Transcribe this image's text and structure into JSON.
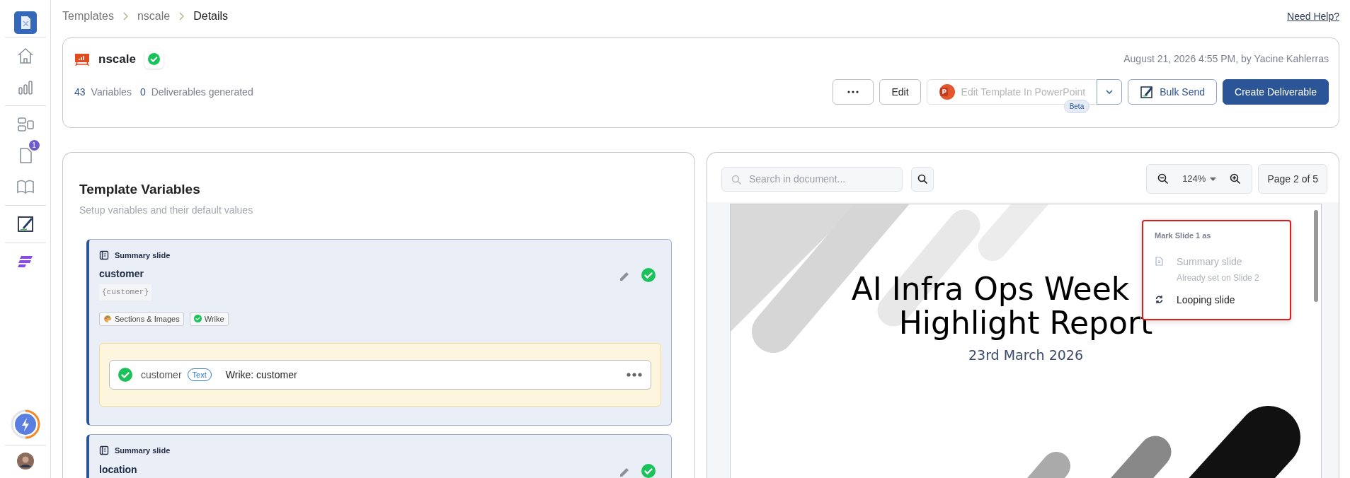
{
  "sidebar": {
    "items": [
      {
        "kind": "home"
      },
      {
        "kind": "chart"
      },
      {
        "kind": "layout"
      },
      {
        "kind": "document",
        "badge": "1"
      },
      {
        "kind": "book"
      },
      {
        "kind": "sign"
      },
      {
        "kind": "brand"
      }
    ]
  },
  "breadcrumb": [
    "Templates",
    "nscale",
    "Details"
  ],
  "help": "Need Help?",
  "template": {
    "name": "nscale",
    "verified": true,
    "updated": "August 21, 2026 4:55 PM, by Yacine Kahlerras",
    "stats": [
      {
        "count": "43",
        "label": "Variables"
      },
      {
        "count": "0",
        "label": "Deliverables generated"
      }
    ],
    "buttons": [
      {
        "kind": "more"
      },
      {
        "kind": "plain",
        "label": "Edit"
      },
      {
        "kind": "powerpoint",
        "label": "Edit Template In PowerPoint",
        "disabled": true,
        "badge": "Beta"
      },
      {
        "kind": "bulk",
        "label": "Bulk Send"
      },
      {
        "kind": "primary",
        "label": "Create Deliverable"
      }
    ]
  },
  "variables_panel": {
    "title": "Template Variables",
    "subtitle": "Setup variables and their default values",
    "variables": [
      {
        "slide_type": "Summary slide",
        "name": "customer",
        "token": "{customer}",
        "verified": true,
        "tags": [
          {
            "kind": "palette",
            "label": "Sections & Images"
          },
          {
            "kind": "check",
            "label": "Wrike"
          }
        ],
        "mappings": [
          {
            "name": "customer",
            "type": "Text",
            "source": "Wrike: customer",
            "verified": true
          }
        ]
      },
      {
        "slide_type": "Summary slide",
        "name": "location",
        "verified": true
      }
    ]
  },
  "viewer": {
    "search_placeholder": "Search in document...",
    "zoom": "124%",
    "page": "Page 2 of 5",
    "slide": {
      "title_lines": [
        "AI Infra Ops Week",
        "Highlight Report"
      ],
      "date": "23rd March 2026"
    },
    "menu": {
      "heading": "Mark Slide 1 as",
      "items": [
        {
          "kind": "summary",
          "label": "Summary slide",
          "note": "Already set on Slide 2",
          "disabled": true
        },
        {
          "kind": "loop",
          "label": "Looping slide",
          "disabled": false
        }
      ]
    }
  }
}
